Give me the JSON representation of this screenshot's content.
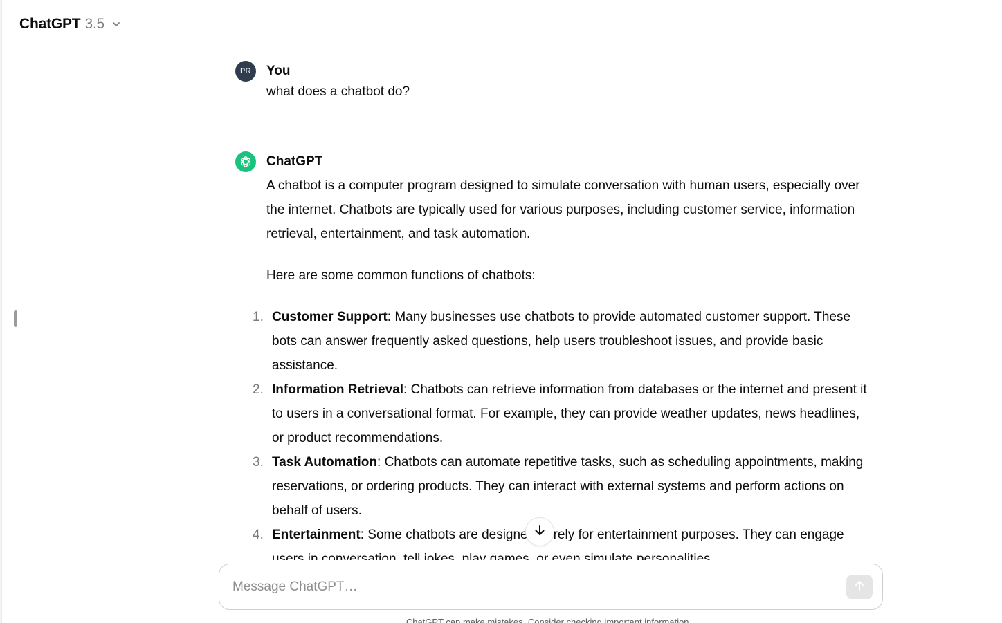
{
  "header": {
    "title": "ChatGPT",
    "version": "3.5"
  },
  "conversation": {
    "user": {
      "avatar_initials": "PR",
      "author": "You",
      "text": "what does a chatbot do?"
    },
    "assistant": {
      "author": "ChatGPT",
      "intro": "A chatbot is a computer program designed to simulate conversation with human users, especially over the internet. Chatbots are typically used for various purposes, including customer service, information retrieval, entertainment, and task automation.",
      "lead": "Here are some common functions of chatbots:",
      "items": [
        {
          "number": "1.",
          "title": "Customer Support",
          "text": ": Many businesses use chatbots to provide automated customer support. These bots can answer frequently asked questions, help users troubleshoot issues, and provide basic assistance."
        },
        {
          "number": "2.",
          "title": "Information Retrieval",
          "text": ": Chatbots can retrieve information from databases or the internet and present it to users in a conversational format. For example, they can provide weather updates, news headlines, or product recommendations."
        },
        {
          "number": "3.",
          "title": "Task Automation",
          "text": ": Chatbots can automate repetitive tasks, such as scheduling appointments, making reservations, or ordering products. They can interact with external systems and perform actions on behalf of users."
        },
        {
          "number": "4.",
          "title": "Entertainment",
          "text": ": Some chatbots are designed purely for entertainment purposes. They can engage users in conversation, tell jokes, play games, or even simulate personalities."
        }
      ]
    }
  },
  "composer": {
    "placeholder": "Message ChatGPT…",
    "value": ""
  },
  "footer": {
    "note": "ChatGPT can make mistakes. Consider checking important information."
  },
  "icons": {
    "header_chevron": "chevron-down-icon",
    "assistant_avatar": "openai-logo-icon",
    "scroll": "arrow-down-icon",
    "send": "arrow-up-icon",
    "sidebar": "sidebar-toggle-icon"
  },
  "colors": {
    "assistant_avatar": "#19c37d",
    "user_avatar": "#2f3d4f",
    "send_disabled": "#e5e5e5",
    "muted_text": "#7d7d7d"
  }
}
